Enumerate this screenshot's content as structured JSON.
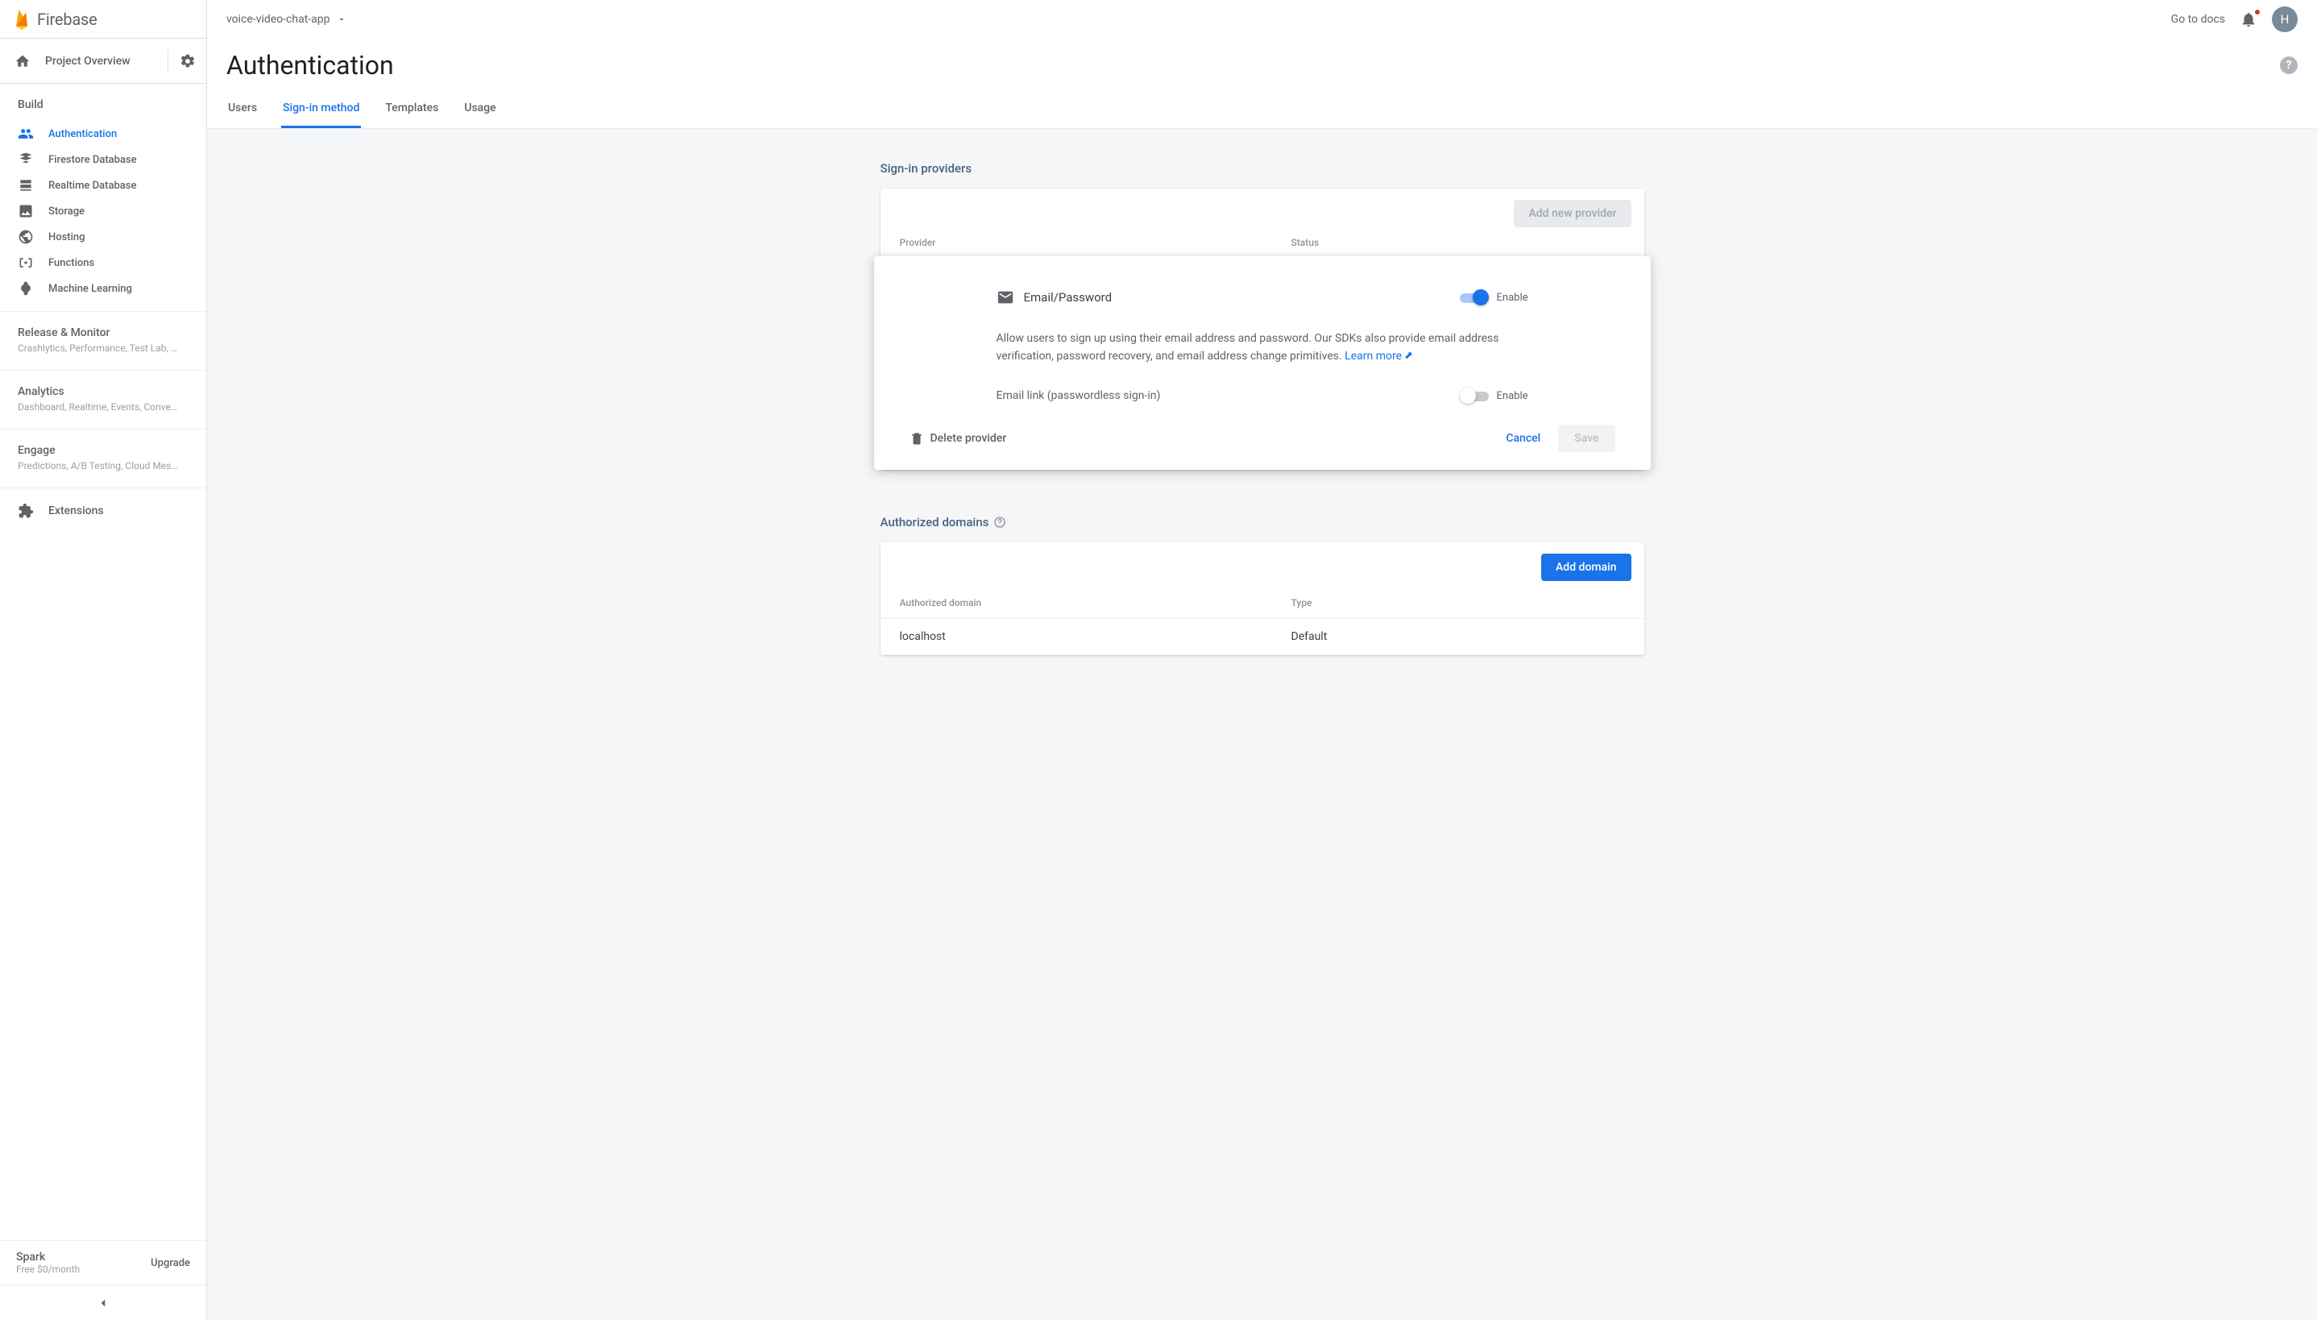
{
  "brand": "Firebase",
  "project_overview": "Project Overview",
  "project_name": "voice-video-chat-app",
  "sidebar": {
    "section_build": "Build",
    "items": [
      {
        "label": "Authentication"
      },
      {
        "label": "Firestore Database"
      },
      {
        "label": "Realtime Database"
      },
      {
        "label": "Storage"
      },
      {
        "label": "Hosting"
      },
      {
        "label": "Functions"
      },
      {
        "label": "Machine Learning"
      }
    ],
    "release": {
      "title": "Release & Monitor",
      "sub": "Crashlytics, Performance, Test Lab, …"
    },
    "analytics": {
      "title": "Analytics",
      "sub": "Dashboard, Realtime, Events, Conve…"
    },
    "engage": {
      "title": "Engage",
      "sub": "Predictions, A/B Testing, Cloud Mes…"
    },
    "extensions": "Extensions",
    "plan": {
      "name": "Spark",
      "price": "Free $0/month",
      "upgrade": "Upgrade"
    }
  },
  "topbar": {
    "docs": "Go to docs",
    "avatar_initial": "H"
  },
  "page": {
    "title": "Authentication",
    "tabs": [
      "Users",
      "Sign-in method",
      "Templates",
      "Usage"
    ],
    "active_tab": 1
  },
  "providers": {
    "section_title": "Sign-in providers",
    "add_button": "Add new provider",
    "col_provider": "Provider",
    "col_status": "Status",
    "edit": {
      "name": "Email/Password",
      "enable_label": "Enable",
      "description": "Allow users to sign up using their email address and password. Our SDKs also provide email address verification, password recovery, and email address change primitives. ",
      "learn_more": "Learn more",
      "email_link_label": "Email link (passwordless sign-in)",
      "delete": "Delete provider",
      "cancel": "Cancel",
      "save": "Save"
    }
  },
  "domains": {
    "section_title": "Authorized domains",
    "add_button": "Add domain",
    "col_domain": "Authorized domain",
    "col_type": "Type",
    "rows": [
      {
        "domain": "localhost",
        "type": "Default"
      }
    ]
  }
}
